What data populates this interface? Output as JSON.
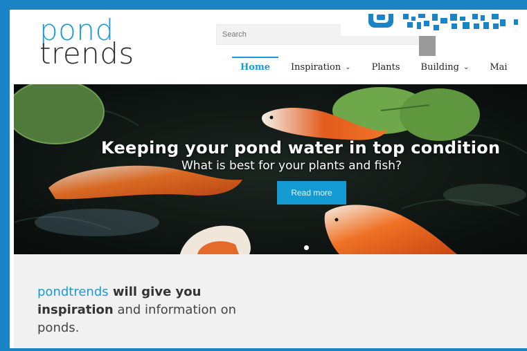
{
  "colors": {
    "accent": "#1a9ad6",
    "frame": "#1a84c6",
    "intro_bg": "#f1f1f1"
  },
  "logo": {
    "top": "pond",
    "bottom": "trends"
  },
  "search": {
    "placeholder": "Search",
    "button_icon": "search-icon"
  },
  "nav": {
    "items": [
      {
        "label": "Home",
        "active": true,
        "has_dropdown": false
      },
      {
        "label": "Inspiration",
        "active": false,
        "has_dropdown": true
      },
      {
        "label": "Plants",
        "active": false,
        "has_dropdown": false
      },
      {
        "label": "Building",
        "active": false,
        "has_dropdown": true
      },
      {
        "label": "Mai",
        "active": false,
        "has_dropdown": false
      }
    ],
    "caret": "⌄"
  },
  "hero": {
    "title": "Keeping your pond water in top condition",
    "subtitle": "What is best for your plants and fish?",
    "button": "Read more"
  },
  "intro": {
    "brand": "pondtrends",
    "part1": " will give you",
    "bold2": "inspiration",
    "part2": " and information on",
    "part3": "ponds."
  }
}
